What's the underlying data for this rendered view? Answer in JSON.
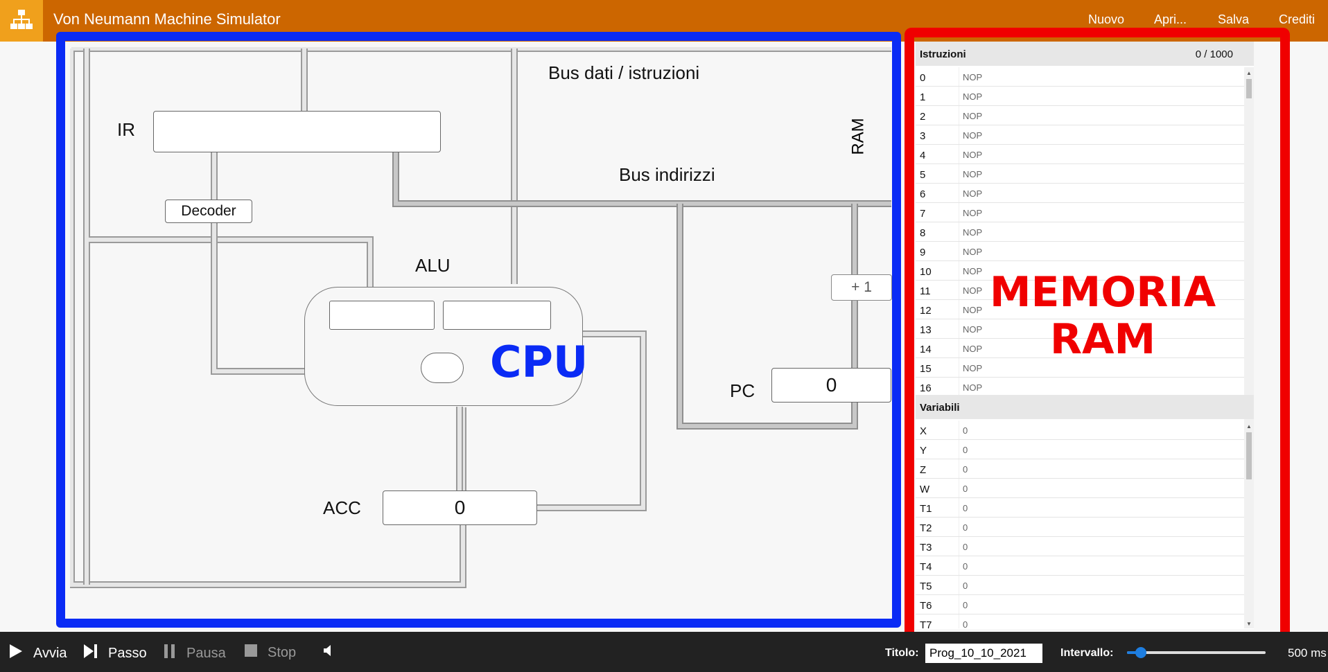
{
  "app": {
    "title": "Von Neumann Machine Simulator",
    "logo_icon": "sitemap-icon",
    "menu": [
      "Nuovo",
      "Apri...",
      "Salva",
      "Crediti"
    ]
  },
  "cpu": {
    "labels": {
      "ir": "IR",
      "decoder": "Decoder",
      "alu": "ALU",
      "acc": "ACC",
      "pc": "PC",
      "ram": "RAM",
      "bus_dati": "Bus dati / istruzioni",
      "bus_indirizzi": "Bus indirizzi",
      "increment": "+ 1"
    },
    "acc_value": "0",
    "pc_value": "0",
    "overlay": "CPU"
  },
  "ram": {
    "instructions_header": "Istruzioni",
    "instructions_count": "0 / 1000",
    "instructions": [
      {
        "addr": "0",
        "value": "NOP"
      },
      {
        "addr": "1",
        "value": "NOP"
      },
      {
        "addr": "2",
        "value": "NOP"
      },
      {
        "addr": "3",
        "value": "NOP"
      },
      {
        "addr": "4",
        "value": "NOP"
      },
      {
        "addr": "5",
        "value": "NOP"
      },
      {
        "addr": "6",
        "value": "NOP"
      },
      {
        "addr": "7",
        "value": "NOP"
      },
      {
        "addr": "8",
        "value": "NOP"
      },
      {
        "addr": "9",
        "value": "NOP"
      },
      {
        "addr": "10",
        "value": "NOP"
      },
      {
        "addr": "11",
        "value": "NOP"
      },
      {
        "addr": "12",
        "value": "NOP"
      },
      {
        "addr": "13",
        "value": "NOP"
      },
      {
        "addr": "14",
        "value": "NOP"
      },
      {
        "addr": "15",
        "value": "NOP"
      },
      {
        "addr": "16",
        "value": "NOP"
      }
    ],
    "variables_header": "Variabili",
    "variables": [
      {
        "name": "X",
        "value": "0"
      },
      {
        "name": "Y",
        "value": "0"
      },
      {
        "name": "Z",
        "value": "0"
      },
      {
        "name": "W",
        "value": "0"
      },
      {
        "name": "T1",
        "value": "0"
      },
      {
        "name": "T2",
        "value": "0"
      },
      {
        "name": "T3",
        "value": "0"
      },
      {
        "name": "T4",
        "value": "0"
      },
      {
        "name": "T5",
        "value": "0"
      },
      {
        "name": "T6",
        "value": "0"
      },
      {
        "name": "T7",
        "value": "0"
      }
    ],
    "overlay_line1": "MEMORIA",
    "overlay_line2": "RAM"
  },
  "controls": {
    "run": "Avvia",
    "step": "Passo",
    "pause": "Pausa",
    "stop": "Stop",
    "sound_icon": "speaker-icon",
    "title_label": "Titolo:",
    "title_value": "Prog_10_10_2021",
    "interval_label": "Intervallo:",
    "interval_value": "500 ms",
    "interval_fraction": 0.1
  },
  "colors": {
    "topbar": "#cc6600",
    "logo_bg": "#f0a01c",
    "cpu_frame": "#0a2bf5",
    "ram_frame": "#f00000",
    "bottombar": "#222222",
    "slider": "#1e7ee0"
  }
}
